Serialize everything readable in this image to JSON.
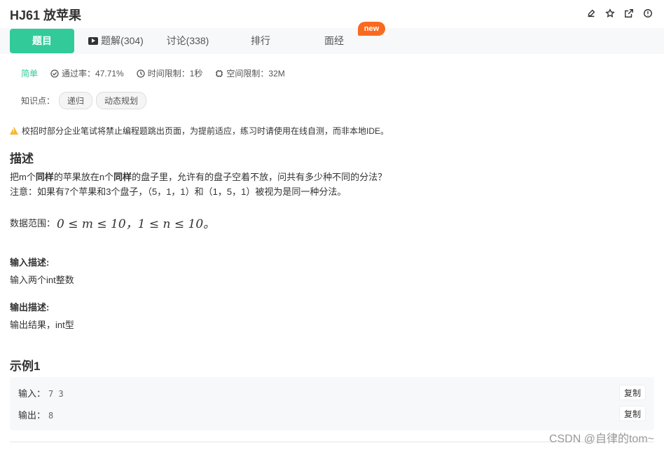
{
  "header": {
    "title": "HJ61  放苹果",
    "icons": [
      "edit-icon",
      "star-icon",
      "share-icon",
      "info-icon"
    ]
  },
  "tabs": [
    {
      "label": "题目",
      "active": true
    },
    {
      "label": "题解(304)",
      "active": false,
      "icon": "video-icon"
    },
    {
      "label": "讨论(338)",
      "active": false
    },
    {
      "label": "排行",
      "active": false
    },
    {
      "label": "面经",
      "active": false
    }
  ],
  "new_badge": "new",
  "meta": {
    "difficulty": "简单",
    "pass_rate": "通过率：47.71%",
    "time_limit": "时间限制：1秒",
    "space_limit": "空间限制：32M"
  },
  "tags": {
    "label": "知识点：",
    "items": [
      "递归",
      "动态规划"
    ]
  },
  "warning": "校招时部分企业笔试将禁止编程题跳出页面，为提前适应，练习时请使用在线自测，而非本地IDE。",
  "description": {
    "heading": "描述",
    "line1_parts": [
      "把m个",
      "同样",
      "的苹果放在n个",
      "同样",
      "的盘子里，允许有的盘子空着不放，问共有多少种不同的分法？"
    ],
    "line2": "注意：如果有7个苹果和3个盘子，（5，1，1）和（1，5，1）被视为是同一种分法。",
    "range_label": "数据范围：",
    "range_math": "0 ≤ m ≤ 10，1 ≤ n ≤ 10。"
  },
  "input_desc": {
    "heading": "输入描述:",
    "text": "输入两个int整数"
  },
  "output_desc": {
    "heading": "输出描述:",
    "text": "输出结果，int型"
  },
  "example": {
    "heading": "示例1",
    "input_label": "输入：",
    "input_value": "7 3",
    "output_label": "输出：",
    "output_value": "8",
    "copy_label": "复制"
  },
  "watermark": "CSDN @自律的tom~",
  "colors": {
    "accent": "#32ca99",
    "badge": "#fa6a1e",
    "warning": "#f5b82e"
  }
}
